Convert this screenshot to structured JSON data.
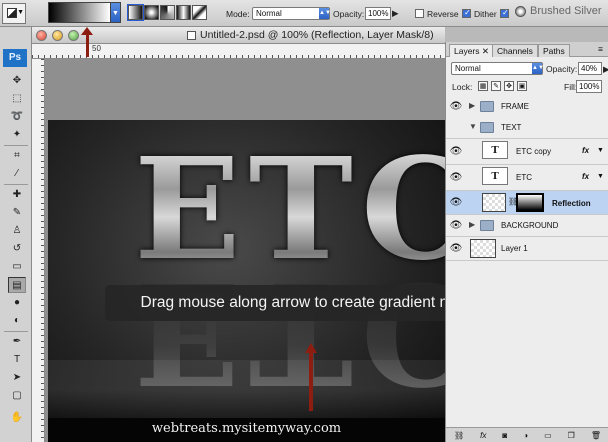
{
  "options_bar": {
    "mode_label": "Mode:",
    "mode_value": "Normal",
    "opacity_label": "Opacity:",
    "opacity_value": "100%",
    "reverse_label": "Reverse",
    "reverse_checked": false,
    "dither_label": "Dither",
    "dither_checked": true,
    "transparency_label": "Tra",
    "transparency_checked": true,
    "preset_name": "Brushed Silver",
    "gradient": "black-to-white",
    "gradient_types": [
      "linear",
      "radial",
      "angle",
      "reflected",
      "diamond"
    ],
    "selected_gradient_type": "linear"
  },
  "toolbox": {
    "logo": "Ps",
    "tools": [
      "move",
      "marquee",
      "lasso",
      "magic-wand",
      "crop",
      "eyedropper",
      "healing",
      "brush",
      "clone-stamp",
      "history-brush",
      "eraser",
      "gradient",
      "blur",
      "dodge",
      "pen",
      "type",
      "path-select",
      "shape",
      "hand",
      "zoom"
    ],
    "active_tool": "gradient"
  },
  "document": {
    "title": "Untitled-2.psd @ 100% (Reflection, Layer Mask/8)",
    "ruler_mark": "50",
    "canvas_text": "ETC",
    "footer_text": "webtreats.mysitemyway.com"
  },
  "tooltip": "Drag mouse along arrow to create gradient mask",
  "arrow_color": "#8c1d10",
  "layers_panel": {
    "tabs": [
      "Layers",
      "Channels",
      "Paths"
    ],
    "active_tab": "Layers",
    "blend_mode": "Normal",
    "opacity_label": "Opacity:",
    "opacity_value": "40%",
    "lock_label": "Lock:",
    "fill_label": "Fill:",
    "fill_value": "100%",
    "layers": [
      {
        "name": "FRAME",
        "kind": "group",
        "expanded": false,
        "visible": true
      },
      {
        "name": "TEXT",
        "kind": "group",
        "expanded": true,
        "visible": false
      },
      {
        "name": "ETC copy",
        "kind": "text",
        "fx": "fx",
        "visible": true
      },
      {
        "name": "ETC",
        "kind": "text",
        "fx": "fx",
        "visible": true
      },
      {
        "name": "Reflection",
        "kind": "pixel-with-mask",
        "selected": true,
        "visible": true
      },
      {
        "name": "BACKGROUND",
        "kind": "group",
        "expanded": false,
        "visible": true
      },
      {
        "name": "Layer 1",
        "kind": "pixel",
        "visible": true
      }
    ],
    "footer_icons": [
      "link-icon",
      "fx-icon",
      "mask-icon",
      "adjustment-icon",
      "folder-icon",
      "new-layer-icon",
      "trash-icon"
    ]
  }
}
